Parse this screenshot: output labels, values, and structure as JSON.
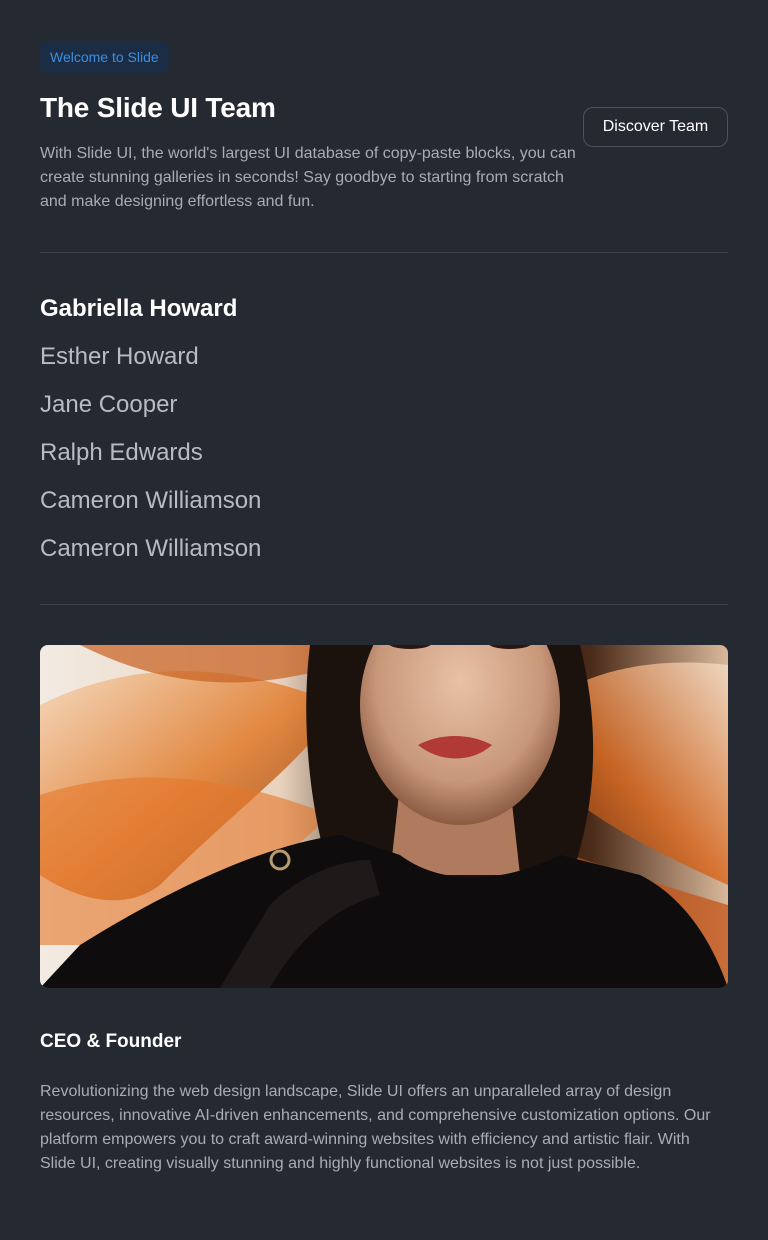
{
  "header": {
    "badge": "Welcome to Slide",
    "title": "The Slide UI Team",
    "description": "With Slide UI, the world's largest UI database of copy-paste blocks, you can create stunning galleries in seconds! Say goodbye to starting from scratch and make designing effortless and fun.",
    "discover_button": "Discover Team"
  },
  "team": {
    "members": [
      {
        "name": "Gabriella Howard",
        "active": true
      },
      {
        "name": "Esther Howard",
        "active": false
      },
      {
        "name": "Jane Cooper",
        "active": false
      },
      {
        "name": "Ralph Edwards",
        "active": false
      },
      {
        "name": "Cameron Williamson",
        "active": false
      },
      {
        "name": "Cameron Williamson",
        "active": false
      }
    ]
  },
  "profile": {
    "role": "CEO & Founder",
    "bio": "Revolutionizing the web design landscape, Slide UI offers an unparalleled array of design resources, innovative AI-driven enhancements, and comprehensive customization options. Our platform empowers you to craft award-winning websites with efficiency and artistic flair. With Slide UI, creating visually stunning and highly functional websites is not just possible."
  },
  "colors": {
    "background": "#252a32",
    "badge_bg": "#1b2d45",
    "badge_text": "#3b8fe0",
    "muted_text": "#a6adb8",
    "divider": "#3d434d"
  }
}
